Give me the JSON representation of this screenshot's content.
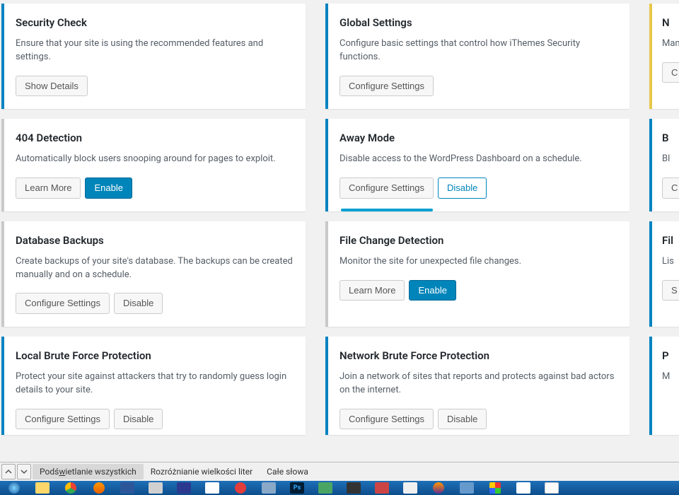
{
  "cards": [
    {
      "title": "Security Check",
      "desc": "Ensure that your site is using the recommended features and settings.",
      "buttons": [
        {
          "label": "Show Details",
          "style": ""
        }
      ],
      "active": true
    },
    {
      "title": "Global Settings",
      "desc": "Configure basic settings that control how iThemes Security functions.",
      "buttons": [
        {
          "label": "Configure Settings",
          "style": ""
        }
      ],
      "active": true
    },
    {
      "title": "N",
      "desc": "Manage rel",
      "buttons": [
        {
          "label": "C",
          "style": ""
        }
      ],
      "yellow": true,
      "partial": true
    },
    {
      "title": "404 Detection",
      "desc": "Automatically block users snooping around for pages to exploit.",
      "buttons": [
        {
          "label": "Learn More",
          "style": ""
        },
        {
          "label": "Enable",
          "style": "primary"
        }
      ],
      "active": false
    },
    {
      "title": "Away Mode",
      "desc": "Disable access to the WordPress Dashboard on a schedule.",
      "buttons": [
        {
          "label": "Configure Settings",
          "style": ""
        },
        {
          "label": "Disable",
          "style": "outline-blue"
        }
      ],
      "active": true,
      "underline": true
    },
    {
      "title": "B",
      "desc": "Bl",
      "buttons": [
        {
          "label": "C",
          "style": ""
        }
      ],
      "active": true,
      "partial": true
    },
    {
      "title": "Database Backups",
      "desc": "Create backups of your site's database. The backups can be created manually and on a schedule.",
      "buttons": [
        {
          "label": "Configure Settings",
          "style": ""
        },
        {
          "label": "Disable",
          "style": ""
        }
      ],
      "active": false
    },
    {
      "title": "File Change Detection",
      "desc": "Monitor the site for unexpected file changes.",
      "buttons": [
        {
          "label": "Learn More",
          "style": ""
        },
        {
          "label": "Enable",
          "style": "primary"
        }
      ],
      "active": false
    },
    {
      "title": "Fil",
      "desc": "Lis",
      "buttons": [
        {
          "label": "S",
          "style": ""
        }
      ],
      "active": true,
      "partial": true
    },
    {
      "title": "Local Brute Force Protection",
      "desc": "Protect your site against attackers that try to randomly guess login details to your site.",
      "buttons": [
        {
          "label": "Configure Settings",
          "style": ""
        },
        {
          "label": "Disable",
          "style": ""
        }
      ],
      "active": true,
      "cut": true
    },
    {
      "title": "Network Brute Force Protection",
      "desc": "Join a network of sites that reports and protects against bad actors on the internet.",
      "buttons": [
        {
          "label": "Configure Settings",
          "style": ""
        },
        {
          "label": "Disable",
          "style": ""
        }
      ],
      "active": true,
      "cut": true
    },
    {
      "title": "P",
      "desc": "M",
      "buttons": [],
      "active": true,
      "partial": true,
      "cut": true
    }
  ],
  "findbar": {
    "highlight": "Podświetlanie wszystkich",
    "case": "Rozróżnianie wielkości liter",
    "whole": "Całe słowa"
  },
  "icons": {
    "up": "chevron-up-icon",
    "down": "chevron-down-icon"
  }
}
